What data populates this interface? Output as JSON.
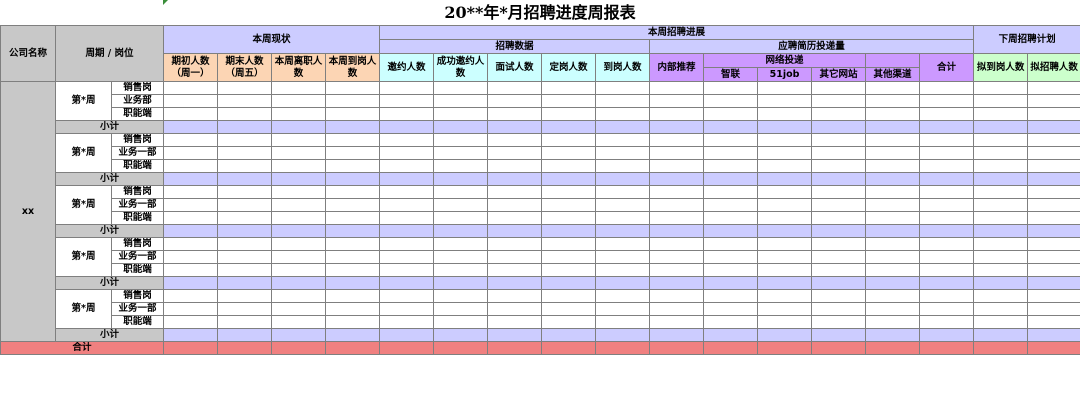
{
  "title": "20**年*月招聘进度周报表",
  "headers": {
    "company": "公司名称",
    "period_position": "周期 / 岗位",
    "current_status": "本周现状",
    "progress": "本周招聘进展",
    "next_plan": "下周招聘计划",
    "recruit_data": "招聘数据",
    "resume_volume": "应聘简历投递量",
    "network": "网络投递",
    "status_cols": [
      "期初人数（周一）",
      "期末人数（周五）",
      "本周离职人数",
      "本周到岗人数"
    ],
    "recruit_cols": [
      "邀约人数",
      "成功邀约人数",
      "面试人数",
      "定岗人数",
      "到岗人数"
    ],
    "internal": "内部推荐",
    "network_cols": [
      "智联",
      "51job",
      "其它网站"
    ],
    "other_channel": "其他渠道",
    "sum": "合计",
    "plan_cols": [
      "拟到岗人数",
      "拟招聘人数"
    ]
  },
  "company": "xx",
  "blocks": [
    {
      "week": "第*周",
      "positions": [
        "销售岗",
        "业务部",
        "职能端"
      ],
      "subtotal": "小计"
    },
    {
      "week": "第*周",
      "positions": [
        "销售岗",
        "业务一部",
        "职能端"
      ],
      "subtotal": "小计"
    },
    {
      "week": "第*周",
      "positions": [
        "销售岗",
        "业务一部",
        "职能端"
      ],
      "subtotal": "小计"
    },
    {
      "week": "第*周",
      "positions": [
        "销售岗",
        "业务一部",
        "职能端"
      ],
      "subtotal": "小计"
    },
    {
      "week": "第*周",
      "positions": [
        "销售岗",
        "业务一部",
        "职能端"
      ],
      "subtotal": "小计"
    }
  ],
  "total_label": "合计",
  "colors": {
    "header_gray": "#c8c8c8",
    "header_lavender": "#ccccff",
    "header_orange": "#fcd5b4",
    "header_cyan": "#ccffff",
    "header_purple": "#cc99ff",
    "header_green": "#ccffcc",
    "total_row": "#f08080"
  }
}
